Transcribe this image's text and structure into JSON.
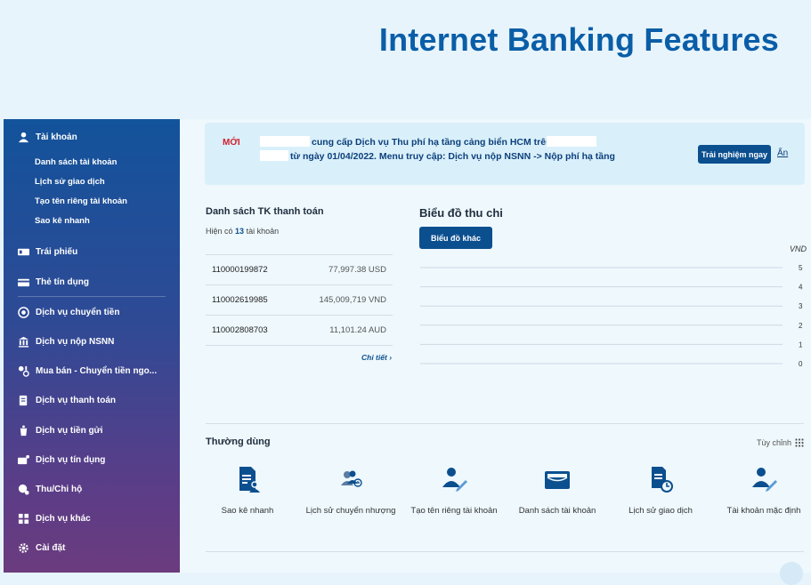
{
  "page": {
    "title": "Internet Banking Features"
  },
  "sidebar": {
    "account": {
      "label": "Tài khoản",
      "subitems": [
        "Danh sách tài khoản",
        "Lịch sử giao dịch",
        "Tạo tên riêng tài khoản",
        "Sao kê nhanh"
      ]
    },
    "items": [
      "Trái phiếu",
      "Thẻ tín dụng",
      "Dịch vụ chuyển tiền",
      "Dịch vụ nộp NSNN",
      "Mua bán - Chuyển tiền ngo...",
      "Dịch vụ thanh toán",
      "Dịch vụ tiền gửi",
      "Dịch vụ tín dụng",
      "Thu/Chi hộ",
      "Dịch vụ khác",
      "Cài đặt"
    ]
  },
  "banner": {
    "badge": "MỚI",
    "line1": "cung cấp Dịch vụ Thu phí hạ tầng cảng biển HCM trên",
    "line2": "từ ngày 01/04/2022. Menu truy cập: Dịch vụ nộp NSNN -> Nộp phí hạ tầng",
    "button": "Trải nghiệm ngay",
    "hide": "Ẩn"
  },
  "accounts": {
    "title": "Danh sách TK thanh toán",
    "count_prefix": "Hiện có",
    "count": "13",
    "count_suffix": "tài khoản",
    "rows": [
      {
        "number": "110000199872",
        "balance": "77,997.38 USD"
      },
      {
        "number": "110002619985",
        "balance": "145,009,719 VND"
      },
      {
        "number": "110002808703",
        "balance": "11,101.24 AUD"
      }
    ],
    "detail_link": "Chi tiết"
  },
  "chart": {
    "title": "Biểu đồ thu chi",
    "button": "Biểu đồ khác",
    "unit": "VND"
  },
  "chart_data": {
    "type": "bar",
    "title": "Biểu đồ thu chi",
    "ylabel": "VND",
    "ylim": [
      0,
      5
    ],
    "yticks": [
      5,
      4,
      3,
      2,
      1,
      0
    ],
    "categories": [],
    "series": [],
    "grid": true
  },
  "frequent": {
    "title": "Thường dùng",
    "customize": "Tùy chỉnh",
    "items": [
      {
        "label": "Sao kê nhanh",
        "icon": "statement-icon"
      },
      {
        "label": "Lịch sử chuyển nhượng",
        "icon": "transfer-history-icon"
      },
      {
        "label": "Tạo tên riêng tài khoản",
        "icon": "user-edit-icon"
      },
      {
        "label": "Danh sách tài khoản",
        "icon": "wallet-icon"
      },
      {
        "label": "Lịch sử giao dịch",
        "icon": "document-clock-icon"
      },
      {
        "label": "Tài khoản mặc định",
        "icon": "user-pen-icon"
      }
    ]
  },
  "colors": {
    "brand": "#0b4f8f",
    "title": "#0a5ea8",
    "badge": "#d21f2a",
    "banner_bg": "#d9f0fb"
  }
}
